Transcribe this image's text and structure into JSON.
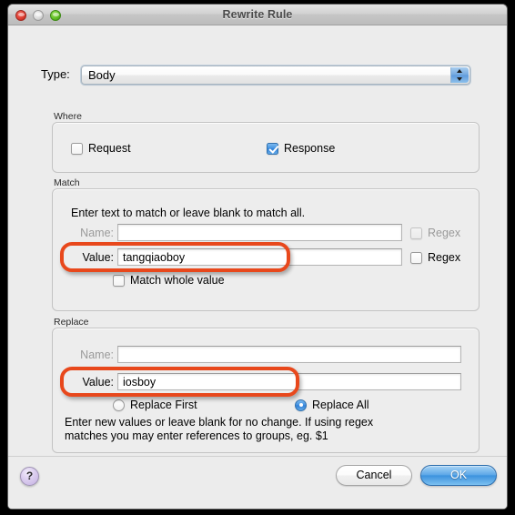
{
  "window": {
    "title": "Rewrite Rule",
    "traffic_lights": [
      "close-light",
      "minimize-light",
      "zoom-light"
    ]
  },
  "type_row": {
    "label": "Type:",
    "selected": "Body",
    "options": [
      "Body"
    ]
  },
  "where": {
    "group_label": "Where",
    "request": {
      "label": "Request",
      "checked": false
    },
    "response": {
      "label": "Response",
      "checked": true
    }
  },
  "match": {
    "group_label": "Match",
    "hint": "Enter text to match or leave blank to match all.",
    "name": {
      "label": "Name:",
      "value": "",
      "disabled": true
    },
    "name_regex": {
      "label": "Regex",
      "checked": false,
      "disabled": true
    },
    "value": {
      "label": "Value:",
      "value": "tangqiaoboy",
      "disabled": false
    },
    "value_regex": {
      "label": "Regex",
      "checked": false,
      "disabled": false
    },
    "match_whole": {
      "label": "Match whole value",
      "checked": false
    }
  },
  "replace": {
    "group_label": "Replace",
    "name": {
      "label": "Name:",
      "value": "",
      "disabled": true
    },
    "value": {
      "label": "Value:",
      "value": "iosboy",
      "disabled": false
    },
    "replace_first": {
      "label": "Replace First",
      "selected": false
    },
    "replace_all": {
      "label": "Replace All",
      "selected": true
    },
    "hint_line1": "Enter new values or leave blank for no change. If using regex",
    "hint_line2": "matches you may enter references to groups, eg. $1"
  },
  "footer": {
    "help": "?",
    "cancel": "Cancel",
    "ok": "OK"
  },
  "annotations": {
    "accent_color": "#e8481c",
    "boxes": [
      "match-value-highlight",
      "replace-value-highlight"
    ]
  }
}
